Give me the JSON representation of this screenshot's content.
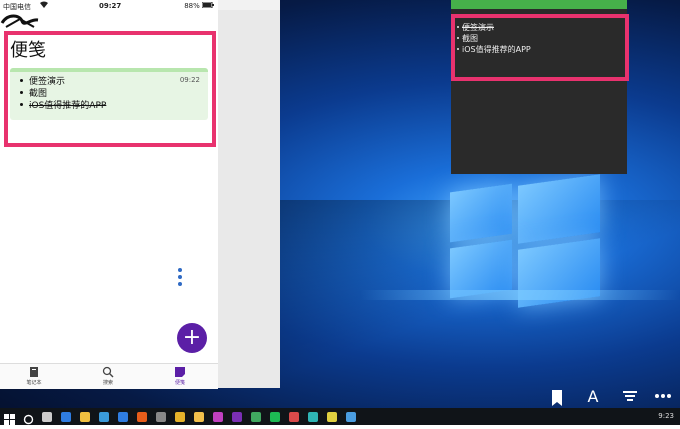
{
  "phone": {
    "status": {
      "carrier": "中国电信",
      "time": "09:27",
      "battery": "88%"
    },
    "title": "便笺",
    "note": {
      "time": "09:22",
      "items": [
        "便签演示",
        "截图",
        "iOS值得推荐的APP"
      ]
    },
    "fab_label": "+",
    "tabs": [
      {
        "label": "笔记本",
        "icon": "notebook-icon"
      },
      {
        "label": "搜索",
        "icon": "search-icon"
      },
      {
        "label": "便笺",
        "icon": "sticky-note-icon"
      }
    ]
  },
  "desktop_sticky": {
    "items": [
      "便签演示",
      "截图",
      "iOS值得推荐的APP"
    ],
    "accent": "#46b04a"
  },
  "desktop_icons": [
    "bookmark-icon",
    "text-icon",
    "sort-icon",
    "more-icon"
  ],
  "taskbar": {
    "clock": "9:23",
    "icons": [
      "windows-start-icon",
      "search-circle-icon",
      "task-view-icon",
      "edge-icon",
      "file-explorer-icon",
      "store-icon",
      "mail-icon",
      "search-app-icon",
      "settings-icon",
      "chrome-icon",
      "folder-icon",
      "app-icon",
      "onenote-icon",
      "media-icon",
      "spotify-icon",
      "photos-icon",
      "app2-icon",
      "app3-icon",
      "sticky-notes-icon"
    ]
  },
  "colors": {
    "highlight": "#e8326e",
    "fab": "#5b1fa6",
    "note_bg": "#e7f5e4"
  }
}
